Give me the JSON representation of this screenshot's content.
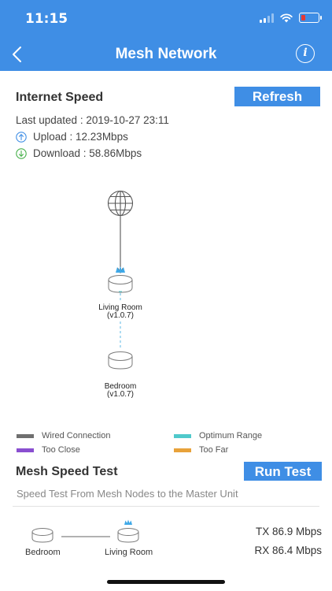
{
  "status_bar": {
    "time": "11:15"
  },
  "header": {
    "title": "Mesh Network",
    "info_glyph": "i"
  },
  "internet_speed": {
    "title": "Internet Speed",
    "refresh_label": "Refresh",
    "last_updated": "Last updated : 2019-10-27 23:11",
    "upload": "Upload : 12.23Mbps",
    "download": "Download : 58.86Mbps"
  },
  "topology": {
    "nodes": [
      {
        "name": "Living Room",
        "version": "(v1.0.7)"
      },
      {
        "name": "Bedroom",
        "version": "(v1.0.7)"
      }
    ]
  },
  "legend": [
    {
      "label": "Wired Connection",
      "color": "#6f6f6f"
    },
    {
      "label": "Optimum Range",
      "color": "#4fc9cb"
    },
    {
      "label": "Too Close",
      "color": "#8a4fd0"
    },
    {
      "label": "Too Far",
      "color": "#e8a23a"
    }
  ],
  "mesh_test": {
    "title": "Mesh Speed Test",
    "run_label": "Run Test",
    "subtitle": "Speed Test From Mesh Nodes to the Master Unit",
    "from_label": "Bedroom",
    "to_label": "Living Room",
    "tx": "TX 86.9 Mbps",
    "rx": "RX 86.4 Mbps"
  },
  "colors": {
    "accent": "#3f8ee5",
    "upload": "#3f8ee5",
    "download": "#46b04a",
    "link": "#5cb8e6",
    "crown": "#3fa9e8"
  },
  "icons": [
    "back-chevron-icon",
    "info-icon",
    "upload-arrow-icon",
    "download-arrow-icon",
    "globe-icon",
    "router-icon",
    "crown-icon"
  ]
}
